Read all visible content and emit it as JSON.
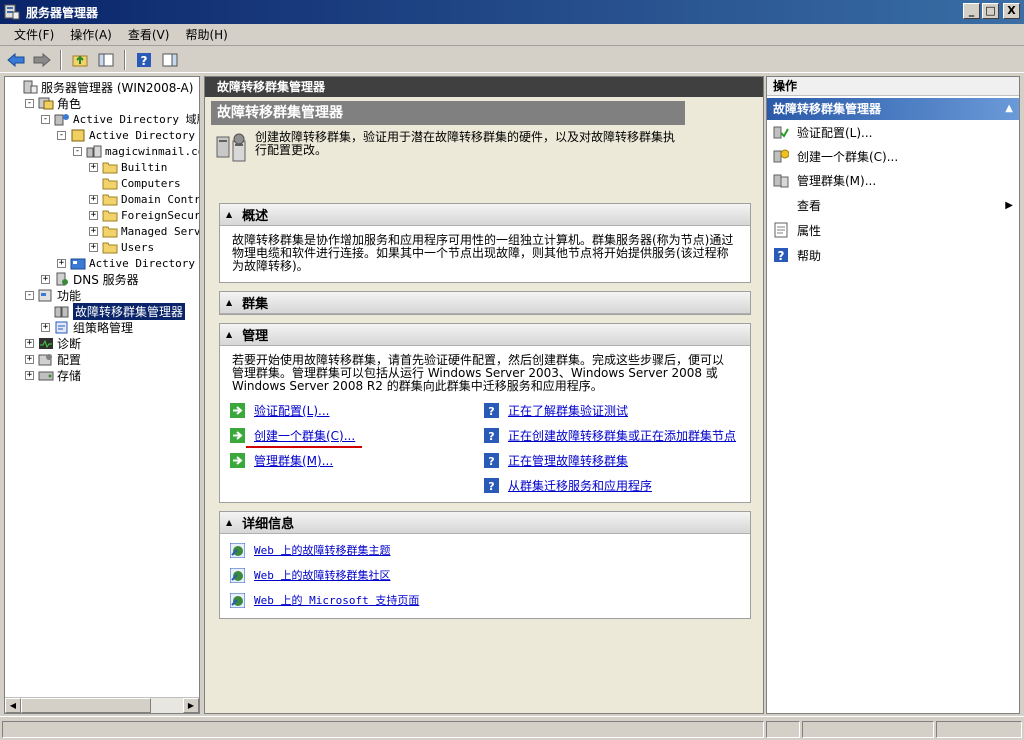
{
  "window": {
    "title": "服务器管理器",
    "min": "_",
    "max": "□",
    "close": "X"
  },
  "menu": [
    "文件(F)",
    "操作(A)",
    "查看(V)",
    "帮助(H)"
  ],
  "tree": [
    {
      "label": "服务器管理器 (WIN2008-A)",
      "indent": 0,
      "exp": "",
      "icon": "server-icon",
      "mono": false
    },
    {
      "label": "角色",
      "indent": 1,
      "exp": "−",
      "icon": "roles-icon",
      "mono": false
    },
    {
      "label": "Active Directory 域服务",
      "indent": 2,
      "exp": "−",
      "icon": "ad-icon",
      "mono": true
    },
    {
      "label": "Active Directory 用户和计算机",
      "indent": 3,
      "exp": "−",
      "icon": "ad-users-icon",
      "mono": true
    },
    {
      "label": "magicwinmail.com",
      "indent": 4,
      "exp": "−",
      "icon": "domain-icon",
      "mono": true
    },
    {
      "label": "Builtin",
      "indent": 5,
      "exp": "+",
      "icon": "folder-icon",
      "mono": true
    },
    {
      "label": "Computers",
      "indent": 5,
      "exp": "",
      "icon": "folder-icon",
      "mono": true
    },
    {
      "label": "Domain Controllers",
      "indent": 5,
      "exp": "+",
      "icon": "folder-icon",
      "mono": true
    },
    {
      "label": "ForeignSecurityPrincipals",
      "indent": 5,
      "exp": "+",
      "icon": "folder-icon",
      "mono": true
    },
    {
      "label": "Managed Service Accounts",
      "indent": 5,
      "exp": "+",
      "icon": "folder-icon",
      "mono": true
    },
    {
      "label": "Users",
      "indent": 5,
      "exp": "+",
      "icon": "folder-icon",
      "mono": true
    },
    {
      "label": "Active Directory 站点和服务",
      "indent": 3,
      "exp": "+",
      "icon": "ad-sites-icon",
      "mono": true
    },
    {
      "label": "DNS 服务器",
      "indent": 2,
      "exp": "+",
      "icon": "dns-icon",
      "mono": false
    },
    {
      "label": "功能",
      "indent": 1,
      "exp": "−",
      "icon": "features-icon",
      "mono": false
    },
    {
      "label": "故障转移群集管理器",
      "indent": 2,
      "exp": "",
      "icon": "cluster-icon",
      "mono": false,
      "selected": true
    },
    {
      "label": "组策略管理",
      "indent": 2,
      "exp": "+",
      "icon": "gpo-icon",
      "mono": false
    },
    {
      "label": "诊断",
      "indent": 1,
      "exp": "+",
      "icon": "diagnostics-icon",
      "mono": false
    },
    {
      "label": "配置",
      "indent": 1,
      "exp": "+",
      "icon": "config-icon",
      "mono": false
    },
    {
      "label": "存储",
      "indent": 1,
      "exp": "+",
      "icon": "storage-icon",
      "mono": false
    }
  ],
  "center": {
    "header": "故障转移群集管理器",
    "snapin_title": "故障转移群集管理器",
    "intro": "创建故障转移群集，验证用于潜在故障转移群集的硬件，以及对故障转移群集执行配置更改。",
    "overview": {
      "title": "概述",
      "text": "故障转移群集是协作增加服务和应用程序可用性的一组独立计算机。群集服务器(称为节点)通过物理电缆和软件进行连接。如果其中一个节点出现故障，则其他节点将开始提供服务(该过程称为故障转移)。"
    },
    "clusters": {
      "title": "群集"
    },
    "manage": {
      "title": "管理",
      "text": "若要开始使用故障转移群集，请首先验证硬件配置，然后创建群集。完成这些步骤后，便可以管理群集。管理群集可以包括从运行 Windows Server 2003、Windows Server 2008 或 Windows Server 2008 R2 的群集向此群集中迁移服务和应用程序。",
      "left_links": [
        "验证配置(L)...",
        "创建一个群集(C)...",
        "管理群集(M)..."
      ],
      "right_links": [
        "正在了解群集验证测试",
        "正在创建故障转移群集或正在添加群集节点",
        "正在管理故障转移群集",
        "从群集迁移服务和应用程序"
      ]
    },
    "details": {
      "title": "详细信息",
      "links": [
        "Web 上的故障转移群集主题",
        "Web 上的故障转移群集社区",
        "Web 上的 Microsoft 支持页面"
      ]
    }
  },
  "actions": {
    "header": "操作",
    "sub": "故障转移群集管理器",
    "items": [
      {
        "label": "验证配置(L)...",
        "icon": "validate-icon"
      },
      {
        "label": "创建一个群集(C)...",
        "icon": "create-cluster-icon"
      },
      {
        "label": "管理群集(M)...",
        "icon": "manage-cluster-icon"
      },
      {
        "label": "查看",
        "icon": "",
        "submenu": true
      },
      {
        "label": "属性",
        "icon": "properties-icon"
      },
      {
        "label": "帮助",
        "icon": "help-icon"
      }
    ]
  }
}
